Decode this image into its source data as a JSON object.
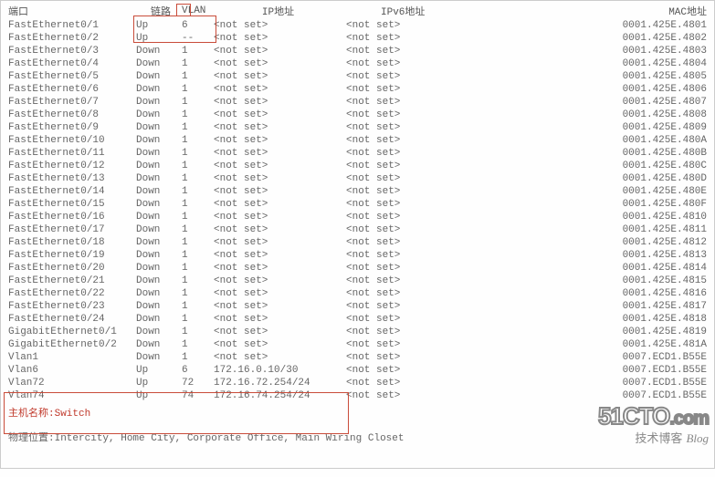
{
  "headers": {
    "port": "端口",
    "link": "链路",
    "vlan": "VLAN",
    "ip": "IP地址",
    "ipv6": "IPv6地址",
    "mac": "MAC地址"
  },
  "rows": [
    {
      "port": "FastEthernet0/1",
      "link": "Up",
      "vlan": "6",
      "ip": "<not set>",
      "ipv6": "<not set>",
      "mac": "0001.425E.4801"
    },
    {
      "port": "FastEthernet0/2",
      "link": "Up",
      "vlan": "--",
      "ip": "<not set>",
      "ipv6": "<not set>",
      "mac": "0001.425E.4802"
    },
    {
      "port": "FastEthernet0/3",
      "link": "Down",
      "vlan": "1",
      "ip": "<not set>",
      "ipv6": "<not set>",
      "mac": "0001.425E.4803"
    },
    {
      "port": "FastEthernet0/4",
      "link": "Down",
      "vlan": "1",
      "ip": "<not set>",
      "ipv6": "<not set>",
      "mac": "0001.425E.4804"
    },
    {
      "port": "FastEthernet0/5",
      "link": "Down",
      "vlan": "1",
      "ip": "<not set>",
      "ipv6": "<not set>",
      "mac": "0001.425E.4805"
    },
    {
      "port": "FastEthernet0/6",
      "link": "Down",
      "vlan": "1",
      "ip": "<not set>",
      "ipv6": "<not set>",
      "mac": "0001.425E.4806"
    },
    {
      "port": "FastEthernet0/7",
      "link": "Down",
      "vlan": "1",
      "ip": "<not set>",
      "ipv6": "<not set>",
      "mac": "0001.425E.4807"
    },
    {
      "port": "FastEthernet0/8",
      "link": "Down",
      "vlan": "1",
      "ip": "<not set>",
      "ipv6": "<not set>",
      "mac": "0001.425E.4808"
    },
    {
      "port": "FastEthernet0/9",
      "link": "Down",
      "vlan": "1",
      "ip": "<not set>",
      "ipv6": "<not set>",
      "mac": "0001.425E.4809"
    },
    {
      "port": "FastEthernet0/10",
      "link": "Down",
      "vlan": "1",
      "ip": "<not set>",
      "ipv6": "<not set>",
      "mac": "0001.425E.480A"
    },
    {
      "port": "FastEthernet0/11",
      "link": "Down",
      "vlan": "1",
      "ip": "<not set>",
      "ipv6": "<not set>",
      "mac": "0001.425E.480B"
    },
    {
      "port": "FastEthernet0/12",
      "link": "Down",
      "vlan": "1",
      "ip": "<not set>",
      "ipv6": "<not set>",
      "mac": "0001.425E.480C"
    },
    {
      "port": "FastEthernet0/13",
      "link": "Down",
      "vlan": "1",
      "ip": "<not set>",
      "ipv6": "<not set>",
      "mac": "0001.425E.480D"
    },
    {
      "port": "FastEthernet0/14",
      "link": "Down",
      "vlan": "1",
      "ip": "<not set>",
      "ipv6": "<not set>",
      "mac": "0001.425E.480E"
    },
    {
      "port": "FastEthernet0/15",
      "link": "Down",
      "vlan": "1",
      "ip": "<not set>",
      "ipv6": "<not set>",
      "mac": "0001.425E.480F"
    },
    {
      "port": "FastEthernet0/16",
      "link": "Down",
      "vlan": "1",
      "ip": "<not set>",
      "ipv6": "<not set>",
      "mac": "0001.425E.4810"
    },
    {
      "port": "FastEthernet0/17",
      "link": "Down",
      "vlan": "1",
      "ip": "<not set>",
      "ipv6": "<not set>",
      "mac": "0001.425E.4811"
    },
    {
      "port": "FastEthernet0/18",
      "link": "Down",
      "vlan": "1",
      "ip": "<not set>",
      "ipv6": "<not set>",
      "mac": "0001.425E.4812"
    },
    {
      "port": "FastEthernet0/19",
      "link": "Down",
      "vlan": "1",
      "ip": "<not set>",
      "ipv6": "<not set>",
      "mac": "0001.425E.4813"
    },
    {
      "port": "FastEthernet0/20",
      "link": "Down",
      "vlan": "1",
      "ip": "<not set>",
      "ipv6": "<not set>",
      "mac": "0001.425E.4814"
    },
    {
      "port": "FastEthernet0/21",
      "link": "Down",
      "vlan": "1",
      "ip": "<not set>",
      "ipv6": "<not set>",
      "mac": "0001.425E.4815"
    },
    {
      "port": "FastEthernet0/22",
      "link": "Down",
      "vlan": "1",
      "ip": "<not set>",
      "ipv6": "<not set>",
      "mac": "0001.425E.4816"
    },
    {
      "port": "FastEthernet0/23",
      "link": "Down",
      "vlan": "1",
      "ip": "<not set>",
      "ipv6": "<not set>",
      "mac": "0001.425E.4817"
    },
    {
      "port": "FastEthernet0/24",
      "link": "Down",
      "vlan": "1",
      "ip": "<not set>",
      "ipv6": "<not set>",
      "mac": "0001.425E.4818"
    },
    {
      "port": "GigabitEthernet0/1",
      "link": "Down",
      "vlan": "1",
      "ip": "<not set>",
      "ipv6": "<not set>",
      "mac": "0001.425E.4819"
    },
    {
      "port": "GigabitEthernet0/2",
      "link": "Down",
      "vlan": "1",
      "ip": "<not set>",
      "ipv6": "<not set>",
      "mac": "0001.425E.481A"
    },
    {
      "port": "Vlan1",
      "link": "Down",
      "vlan": "1",
      "ip": "<not set>",
      "ipv6": "<not set>",
      "mac": "0007.ECD1.B55E"
    },
    {
      "port": "Vlan6",
      "link": "Up",
      "vlan": "6",
      "ip": "172.16.0.10/30",
      "ipv6": "<not set>",
      "mac": "0007.ECD1.B55E"
    },
    {
      "port": "Vlan72",
      "link": "Up",
      "vlan": "72",
      "ip": "172.16.72.254/24",
      "ipv6": "<not set>",
      "mac": "0007.ECD1.B55E"
    },
    {
      "port": "Vlan74",
      "link": "Up",
      "vlan": "74",
      "ip": "172.16.74.254/24",
      "ipv6": "<not set>",
      "mac": "0007.ECD1.B55E"
    }
  ],
  "hostname_label": "主机名称:",
  "hostname_value": "Switch",
  "location_label": "物理位置:",
  "location_value": "Intercity, Home City, Corporate Office, Main Wiring Closet",
  "watermark": {
    "logo": "51CTO",
    "suffix": ".com",
    "sub": "技术博客",
    "blog": "Blog"
  }
}
